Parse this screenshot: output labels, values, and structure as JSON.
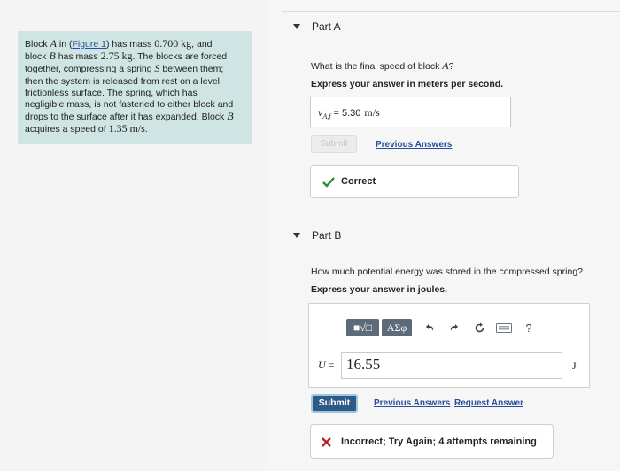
{
  "problem": {
    "text_before_figure": "Block ",
    "block_a": "A",
    "in_word": " in (",
    "figure_link": "Figure 1",
    "after_figure": ") has mass ",
    "mass_a": "0.700",
    "unit_kg": "kg",
    "and_text": ", and",
    "block_b_prefix": "block ",
    "block_b": "B",
    "has_mass": " has mass ",
    "mass_b": "2.75",
    "line2_rest": ". The blocks are forced",
    "line3": "together, compressing a spring ",
    "spring": "S",
    "line3_rest": " between them;",
    "line4": "then the system is released from rest on a level,",
    "line5": "frictionless surface. The spring, which has",
    "line6": "negligible mass, is not fastened to either block and",
    "line7": "drops to the surface after it has expanded. Block ",
    "line8": "acquires a speed of ",
    "speed_b": "1.35",
    "unit_ms": "m/s",
    "period": "."
  },
  "part_a": {
    "title": "Part A",
    "question_prefix": "What is the final speed of block ",
    "question_var": "A",
    "question_suffix": "?",
    "instruction": "Express your answer in meters per second.",
    "answer_var": "v",
    "answer_sub": "A,f",
    "answer_eq": " = ",
    "answer_value": "5.30",
    "answer_unit": "m/s",
    "submit_label": "Submit",
    "previous_answers": "Previous Answers",
    "feedback": "Correct",
    "feedback_color": "#2e8b2e"
  },
  "part_b": {
    "title": "Part B",
    "question": "How much potential energy was stored in the compressed spring?",
    "instruction": "Express your answer in joules.",
    "toolbar": {
      "templates_label": "■√□",
      "symbols_label": "ΑΣφ",
      "undo_icon": "undo-icon",
      "redo_icon": "redo-icon",
      "reset_icon": "reset-icon",
      "keyboard_icon": "keyboard-icon",
      "help_label": "?"
    },
    "variable": "U",
    "equals": " = ",
    "input_value": "16.55",
    "unit": "J",
    "submit_label": "Submit",
    "previous_answers": "Previous Answers",
    "request_answer": "Request Answer",
    "feedback": "Incorrect; Try Again; 4 attempts remaining",
    "feedback_color": "#b22222",
    "accent_color": "#2e5b86"
  }
}
